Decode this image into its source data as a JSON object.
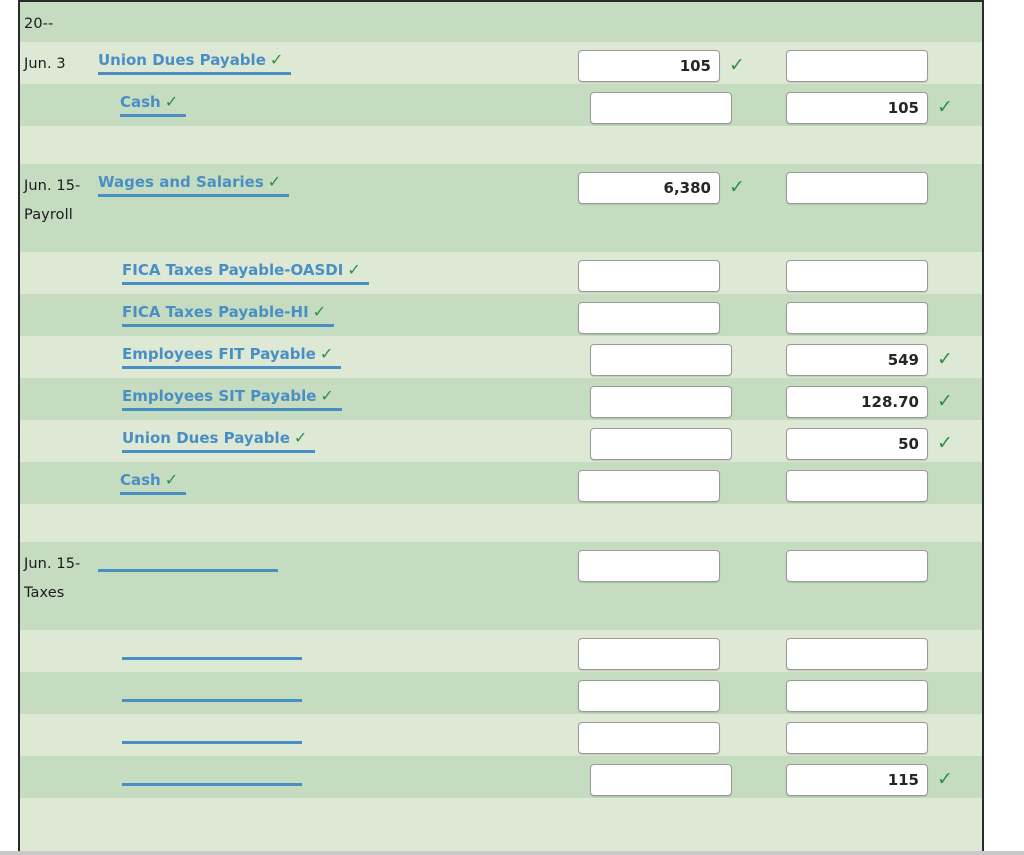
{
  "journal": {
    "year_header": "20--",
    "check_glyph": "✓",
    "colors": {
      "row_dark": "#c6dcc1",
      "row_light": "#dde8d5",
      "account_link": "#4a8fc4",
      "check_mark": "#2e9142",
      "frame_border": "#2a2a2a",
      "input_border": "#9a9a9a",
      "text": "#1b1b1b"
    },
    "rows": [
      {
        "kind": "year",
        "stripe": "dark",
        "date": "20--",
        "account": "",
        "indent": "ind0",
        "debit": "",
        "credit": "",
        "debit_check": false,
        "credit_check": false,
        "has_account_link": false,
        "has_blank": false
      },
      {
        "kind": "entry",
        "stripe": "light",
        "date": "Jun. 3",
        "account": "Union Dues Payable",
        "indent": "ind0",
        "debit": "105",
        "credit": "",
        "debit_check": true,
        "credit_check": false,
        "has_account_link": true,
        "has_blank": false
      },
      {
        "kind": "entry",
        "stripe": "dark",
        "date": "",
        "account": "Cash",
        "indent": "ind1",
        "debit": "",
        "credit": "105",
        "debit_check": false,
        "credit_check": true,
        "has_account_link": true,
        "has_blank": false
      },
      {
        "kind": "spacer",
        "stripe": "light",
        "date": "",
        "account": "",
        "indent": "ind0",
        "debit": "",
        "credit": "",
        "debit_check": false,
        "credit_check": false,
        "has_account_link": false,
        "has_blank": false
      },
      {
        "kind": "entry",
        "stripe": "dark",
        "date": "Jun. 15-Payroll",
        "account": "Wages and Salaries",
        "indent": "ind0",
        "debit": "6,380",
        "credit": "",
        "debit_check": true,
        "credit_check": false,
        "has_account_link": true,
        "has_blank": false
      },
      {
        "kind": "entry",
        "stripe": "light",
        "date": "",
        "account": "FICA Taxes Payable-OASDI",
        "indent": "ind2",
        "debit": "",
        "credit": "",
        "debit_check": false,
        "credit_check": false,
        "has_account_link": true,
        "has_blank": false
      },
      {
        "kind": "entry",
        "stripe": "dark",
        "date": "",
        "account": "FICA Taxes Payable-HI",
        "indent": "ind2",
        "debit": "",
        "credit": "",
        "debit_check": false,
        "credit_check": false,
        "has_account_link": true,
        "has_blank": false
      },
      {
        "kind": "entry",
        "stripe": "light",
        "date": "",
        "account": "Employees FIT Payable",
        "indent": "ind2",
        "debit": "",
        "credit": "549",
        "debit_check": false,
        "credit_check": true,
        "has_account_link": true,
        "has_blank": false
      },
      {
        "kind": "entry",
        "stripe": "dark",
        "date": "",
        "account": "Employees SIT Payable",
        "indent": "ind2",
        "debit": "",
        "credit": "128.70",
        "debit_check": false,
        "credit_check": true,
        "has_account_link": true,
        "has_blank": false
      },
      {
        "kind": "entry",
        "stripe": "light",
        "date": "",
        "account": "Union Dues Payable",
        "indent": "ind2",
        "debit": "",
        "credit": "50",
        "debit_check": false,
        "credit_check": true,
        "has_account_link": true,
        "has_blank": false
      },
      {
        "kind": "entry",
        "stripe": "dark",
        "date": "",
        "account": "Cash",
        "indent": "ind1",
        "debit": "",
        "credit": "",
        "debit_check": false,
        "credit_check": false,
        "has_account_link": true,
        "has_blank": false
      },
      {
        "kind": "spacer",
        "stripe": "light",
        "date": "",
        "account": "",
        "indent": "ind0",
        "debit": "",
        "credit": "",
        "debit_check": false,
        "credit_check": false,
        "has_account_link": false,
        "has_blank": false
      },
      {
        "kind": "entry",
        "stripe": "dark",
        "date": "Jun. 15-Taxes",
        "account": "",
        "indent": "ind0",
        "debit": "",
        "credit": "",
        "debit_check": false,
        "credit_check": false,
        "has_account_link": false,
        "has_blank": true,
        "blank_width": 180
      },
      {
        "kind": "entry",
        "stripe": "light",
        "date": "",
        "account": "",
        "indent": "ind2",
        "debit": "",
        "credit": "",
        "debit_check": false,
        "credit_check": false,
        "has_account_link": false,
        "has_blank": true,
        "blank_width": 180
      },
      {
        "kind": "entry",
        "stripe": "dark",
        "date": "",
        "account": "",
        "indent": "ind2",
        "debit": "",
        "credit": "",
        "debit_check": false,
        "credit_check": false,
        "has_account_link": false,
        "has_blank": true,
        "blank_width": 180
      },
      {
        "kind": "entry",
        "stripe": "light",
        "date": "",
        "account": "",
        "indent": "ind2",
        "debit": "",
        "credit": "",
        "debit_check": false,
        "credit_check": false,
        "has_account_link": false,
        "has_blank": true,
        "blank_width": 180
      },
      {
        "kind": "entry",
        "stripe": "dark",
        "date": "",
        "account": "",
        "indent": "ind2",
        "debit": "",
        "credit": "115",
        "debit_check": false,
        "credit_check": true,
        "has_account_link": false,
        "has_blank": true,
        "blank_width": 180
      },
      {
        "kind": "spacer",
        "stripe": "light",
        "date": "",
        "account": "",
        "indent": "ind0",
        "debit": "",
        "credit": "",
        "debit_check": false,
        "credit_check": false,
        "has_account_link": false,
        "has_blank": false
      }
    ]
  }
}
